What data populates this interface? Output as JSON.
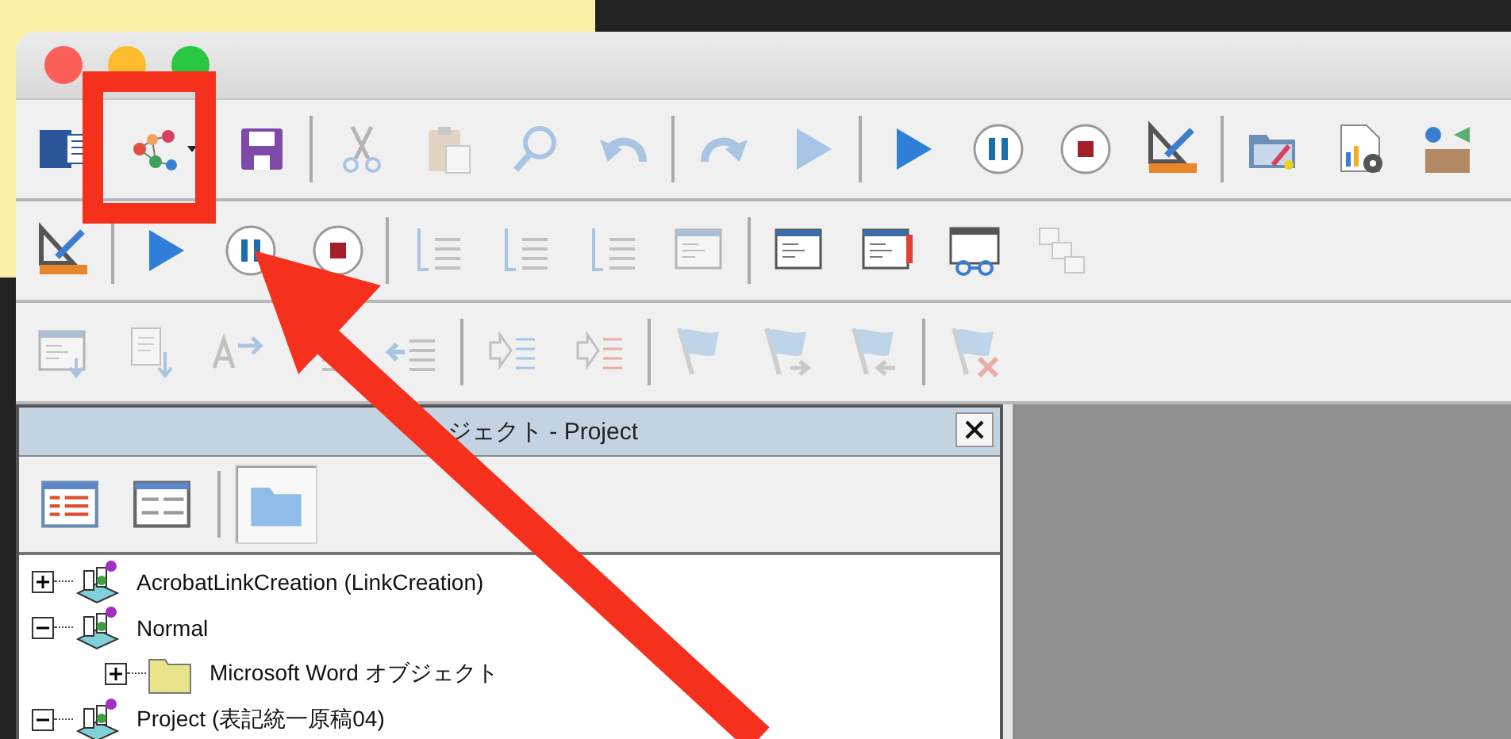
{
  "toolbars": [
    {
      "items": [
        {
          "kind": "word",
          "disabled": false
        },
        {
          "kind": "macros",
          "disabled": false,
          "dropdown": true
        },
        {
          "kind": "save",
          "disabled": false
        },
        {
          "kind": "separator"
        },
        {
          "kind": "cut",
          "disabled": true
        },
        {
          "kind": "paste",
          "disabled": true
        },
        {
          "kind": "find",
          "disabled": true
        },
        {
          "kind": "undo",
          "disabled": true
        },
        {
          "kind": "separator"
        },
        {
          "kind": "redo",
          "disabled": true
        },
        {
          "kind": "run",
          "disabled": true
        },
        {
          "kind": "separator"
        },
        {
          "kind": "run",
          "disabled": false
        },
        {
          "kind": "pause",
          "disabled": false
        },
        {
          "kind": "stop",
          "disabled": false
        },
        {
          "kind": "design",
          "disabled": false
        },
        {
          "kind": "separator"
        },
        {
          "kind": "folder-pic",
          "disabled": false
        },
        {
          "kind": "doc-gear",
          "disabled": false
        },
        {
          "kind": "boxes",
          "disabled": false
        }
      ]
    },
    {
      "items": [
        {
          "kind": "design",
          "disabled": false
        },
        {
          "kind": "separator"
        },
        {
          "kind": "run",
          "disabled": false
        },
        {
          "kind": "pause",
          "disabled": false
        },
        {
          "kind": "stop",
          "disabled": false
        },
        {
          "kind": "separator"
        },
        {
          "kind": "step-in",
          "disabled": true
        },
        {
          "kind": "step-over",
          "disabled": true
        },
        {
          "kind": "step-out",
          "disabled": true
        },
        {
          "kind": "window",
          "disabled": true
        },
        {
          "kind": "separator"
        },
        {
          "kind": "window",
          "disabled": false
        },
        {
          "kind": "window-alert",
          "disabled": false
        },
        {
          "kind": "window-glasses",
          "disabled": false
        },
        {
          "kind": "stack",
          "disabled": true
        }
      ]
    },
    {
      "items": [
        {
          "kind": "list-down",
          "disabled": true
        },
        {
          "kind": "doc-down",
          "disabled": true
        },
        {
          "kind": "text-arrow",
          "disabled": true
        },
        {
          "kind": "indent",
          "disabled": true
        },
        {
          "kind": "outdent",
          "disabled": true
        },
        {
          "kind": "separator"
        },
        {
          "kind": "comment",
          "disabled": true
        },
        {
          "kind": "uncomment",
          "disabled": true
        },
        {
          "kind": "separator"
        },
        {
          "kind": "flag",
          "disabled": true
        },
        {
          "kind": "flag-next",
          "disabled": true
        },
        {
          "kind": "flag-prev",
          "disabled": true
        },
        {
          "kind": "separator"
        },
        {
          "kind": "flag-clear",
          "disabled": true
        }
      ]
    }
  ],
  "project_panel": {
    "title": "ジェクト - Project",
    "view_buttons": [
      {
        "kind": "code",
        "selected": false
      },
      {
        "kind": "object",
        "selected": false
      },
      {
        "kind": "folders",
        "selected": true
      }
    ],
    "tree": [
      {
        "label": "AcrobatLinkCreation (LinkCreation)",
        "kind": "project",
        "expanded": false
      },
      {
        "label": "Normal",
        "kind": "project",
        "expanded": true,
        "children": [
          {
            "label": "Microsoft Word オブジェクト",
            "kind": "folder",
            "expanded": false
          }
        ]
      },
      {
        "label": "Project (表記統一原稿04)",
        "kind": "project",
        "expanded": true
      }
    ]
  },
  "highlight_frame": true,
  "pointer_arrow": true
}
